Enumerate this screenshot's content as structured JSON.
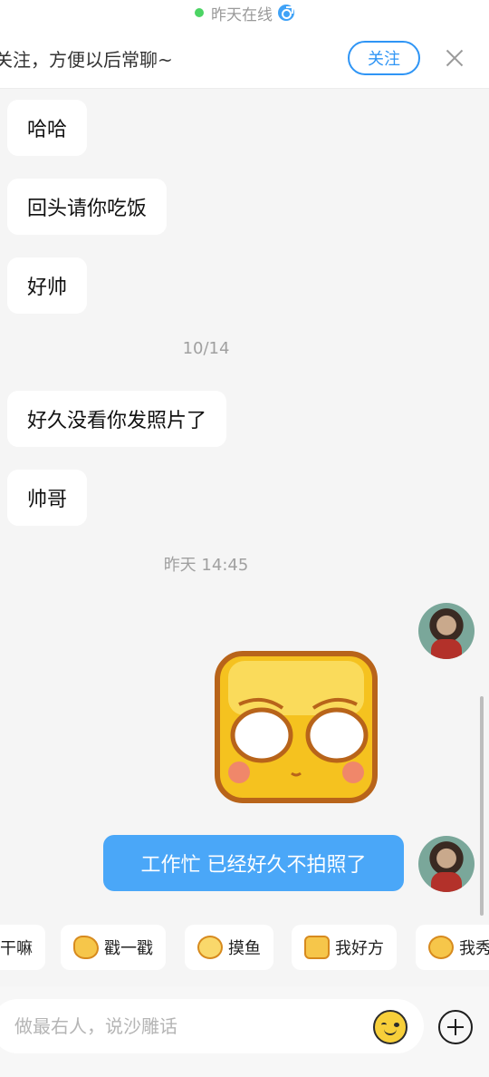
{
  "header": {
    "online_status": "昨天在线",
    "follow_prompt": "关注，方便以后常聊~",
    "follow_button": "关注"
  },
  "messages": [
    {
      "side": "left",
      "text": "哈哈"
    },
    {
      "side": "left",
      "text": "回头请你吃饭"
    },
    {
      "side": "left",
      "text": "好帅"
    },
    {
      "type": "timestamp",
      "text": "10/14"
    },
    {
      "side": "left",
      "text": "好久没看你发照片了"
    },
    {
      "side": "left",
      "text": "帅哥"
    },
    {
      "type": "timestamp",
      "text": "昨天 14:45"
    },
    {
      "side": "right",
      "type": "sticker"
    },
    {
      "side": "right",
      "text": "工作忙 已经好久不拍照了"
    }
  ],
  "quick_replies": [
    {
      "label": "干嘛",
      "icon": "none"
    },
    {
      "label": "戳一戳",
      "icon": "pointing-hand-icon"
    },
    {
      "label": "摸鱼",
      "icon": "fish-face-icon"
    },
    {
      "label": "我好方",
      "icon": "square-face-icon"
    },
    {
      "label": "我秀",
      "icon": "smirk-face-icon"
    }
  ],
  "input": {
    "placeholder": "做最右人，说沙雕话"
  },
  "colors": {
    "accent": "#2f95f5",
    "outgoing_bubble": "#4aa7f8",
    "online_dot": "#4cd464",
    "background": "#f5f5f5"
  }
}
